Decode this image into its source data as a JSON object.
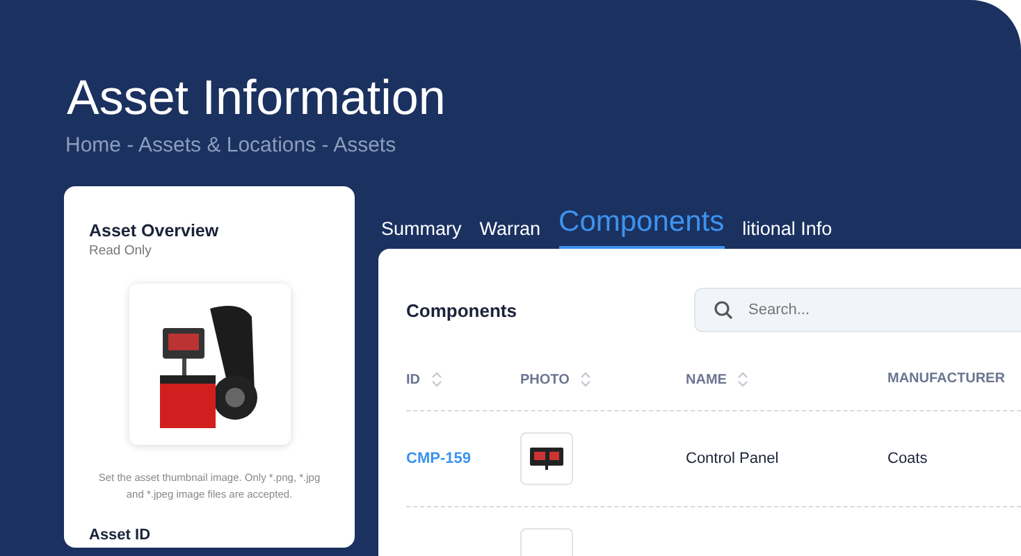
{
  "page": {
    "title": "Asset Information",
    "breadcrumb": "Home - Assets & Locations - Assets"
  },
  "overview": {
    "title": "Asset Overview",
    "subtitle": "Read Only",
    "hint": "Set the asset thumbnail image. Only *.png, *.jpg and *.jpeg image files are accepted.",
    "field_label": "Asset ID"
  },
  "tabs": [
    {
      "label": "Summary",
      "selected": false
    },
    {
      "label": "Warran",
      "selected": false
    },
    {
      "label": "Components",
      "selected": true
    },
    {
      "label": "litional Info",
      "selected": false
    }
  ],
  "components": {
    "title": "Components",
    "search": {
      "placeholder": "Search..."
    },
    "columns": [
      {
        "label": "ID",
        "sortable": true
      },
      {
        "label": "PHOTO",
        "sortable": true
      },
      {
        "label": "NAME",
        "sortable": true
      },
      {
        "label": "MANUFACTURER",
        "sortable": false
      }
    ],
    "rows": [
      {
        "id": "CMP-159",
        "name": "Control Panel",
        "manufacturer": "Coats"
      },
      {}
    ]
  }
}
